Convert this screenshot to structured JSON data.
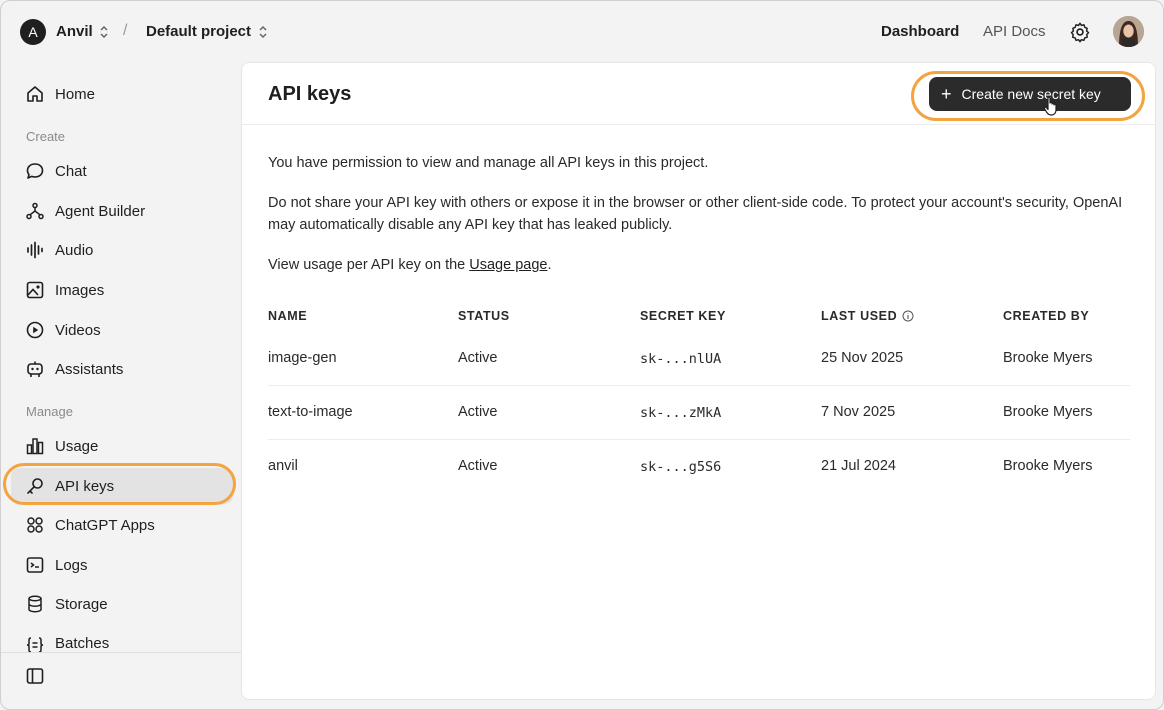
{
  "topbar": {
    "org_initial": "A",
    "org_name": "Anvil",
    "separator": "/",
    "project_name": "Default project",
    "nav_dashboard": "Dashboard",
    "nav_api_docs": "API Docs"
  },
  "sidebar": {
    "items_top": [
      {
        "label": "Home",
        "icon": "home-icon"
      }
    ],
    "section_create": "Create",
    "items_create": [
      {
        "label": "Chat",
        "icon": "chat-icon"
      },
      {
        "label": "Agent Builder",
        "icon": "agent-builder-icon"
      },
      {
        "label": "Audio",
        "icon": "audio-icon"
      },
      {
        "label": "Images",
        "icon": "images-icon"
      },
      {
        "label": "Videos",
        "icon": "videos-icon"
      },
      {
        "label": "Assistants",
        "icon": "assistants-icon"
      }
    ],
    "section_manage": "Manage",
    "items_manage": [
      {
        "label": "Usage",
        "icon": "usage-icon"
      },
      {
        "label": "API keys",
        "icon": "key-icon",
        "active": true
      },
      {
        "label": "ChatGPT Apps",
        "icon": "apps-icon"
      },
      {
        "label": "Logs",
        "icon": "logs-icon"
      },
      {
        "label": "Storage",
        "icon": "storage-icon"
      },
      {
        "label": "Batches",
        "icon": "batches-icon"
      }
    ]
  },
  "main": {
    "title": "API keys",
    "create_button": "Create new secret key",
    "para1": "You have permission to view and manage all API keys in this project.",
    "para2": "Do not share your API key with others or expose it in the browser or other client-side code. To protect your account's security, OpenAI may automatically disable any API key that has leaked publicly.",
    "para3_prefix": "View usage per API key on the ",
    "para3_link": "Usage page",
    "para3_suffix": ".",
    "table": {
      "headers": [
        "NAME",
        "STATUS",
        "SECRET KEY",
        "LAST USED",
        "CREATED BY"
      ],
      "rows": [
        {
          "name": "image-gen",
          "status": "Active",
          "key": "sk-...nlUA",
          "last_used": "25 Nov 2025",
          "created_by": "Brooke Myers"
        },
        {
          "name": "text-to-image",
          "status": "Active",
          "key": "sk-...zMkA",
          "last_used": "7 Nov 2025",
          "created_by": "Brooke Myers"
        },
        {
          "name": "anvil",
          "status": "Active",
          "key": "sk-...g5S6",
          "last_used": "21 Jul 2024",
          "created_by": "Brooke Myers"
        }
      ]
    }
  },
  "colors": {
    "accent_highlight": "#f3a340",
    "button_bg": "#2b2b2b"
  }
}
